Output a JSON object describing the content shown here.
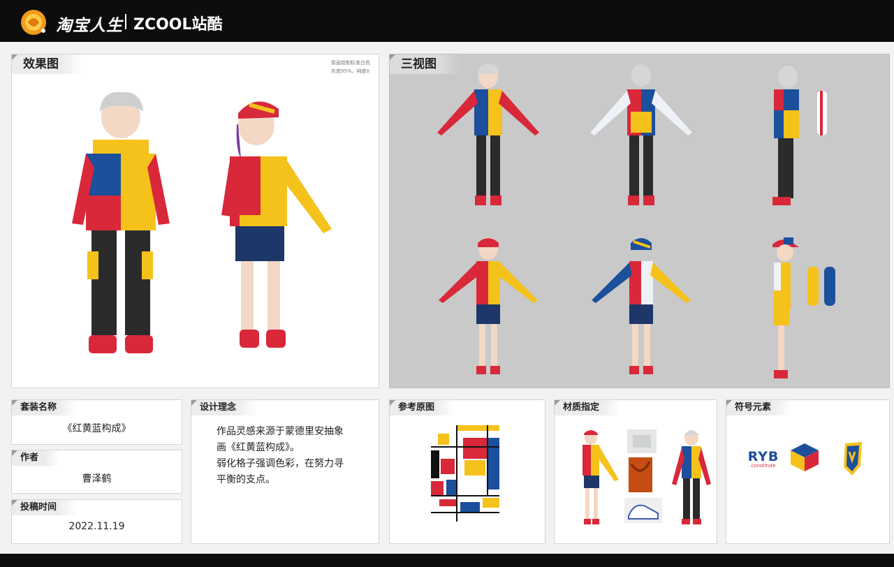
{
  "header": {
    "brand_cn": "淘宝人生",
    "brand_zcool": "ZCOOL站酷"
  },
  "panels": {
    "effect": {
      "title": "效果图",
      "note_line1": "原画绘制标准白色",
      "note_line2": "灰度95%，纯度0"
    },
    "three_view": {
      "title": "三视图"
    },
    "outfit_name": {
      "title": "套装名称",
      "value": "《红黄蓝构成》"
    },
    "author": {
      "title": "作者",
      "value": "曹泽鹤"
    },
    "post_time": {
      "title": "投稿时间",
      "value": "2022.11.19"
    },
    "concept": {
      "title": "设计理念",
      "line1": "作品灵感来源于蒙德里安抽象",
      "line2": "画《红黄蓝构成》。",
      "line3": "弱化格子强调色彩，在努力寻",
      "line4": "平衡的支点。"
    },
    "reference": {
      "title": "参考原图"
    },
    "material": {
      "title": "材质指定"
    },
    "symbols": {
      "title": "符号元素",
      "ryb_logo_text": "RYB",
      "ryb_logo_sub": "constitute"
    }
  },
  "colors": {
    "red": "#d8283a",
    "yellow": "#f5c21b",
    "blue": "#1c4f9c",
    "dark": "#0d0d0d",
    "grey_panel": "#c9c9c9"
  },
  "icons": [
    "taobao-life-logo-icon",
    "ryb-cube-icon",
    "shield-badge-icon"
  ]
}
